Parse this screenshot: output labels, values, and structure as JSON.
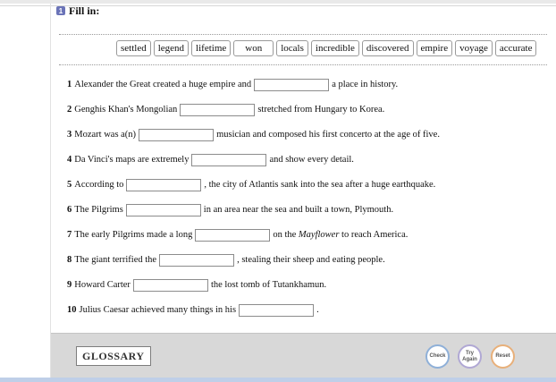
{
  "exercise": {
    "badge": "1",
    "title": "Fill in:"
  },
  "word_bank": [
    "settled",
    "legend",
    "lifetime",
    "won",
    "locals",
    "incredible",
    "discovered",
    "empire",
    "voyage",
    "accurate"
  ],
  "sentences": [
    {
      "num": "1",
      "before": "Alexander the Great created a huge empire and",
      "after": "a place in history."
    },
    {
      "num": "2",
      "before": "Genghis Khan's Mongolian",
      "after": "stretched from Hungary to Korea."
    },
    {
      "num": "3",
      "before": "Mozart was a(n)",
      "after": "musician and composed his first concerto at the age of five."
    },
    {
      "num": "4",
      "before": "Da Vinci's maps are extremely",
      "after": "and show every detail."
    },
    {
      "num": "5",
      "before": "According to",
      "after": ", the city of Atlantis sank into the sea after a huge earthquake."
    },
    {
      "num": "6",
      "before": "The Pilgrims",
      "after": "in an area near the sea and built a town, Plymouth."
    },
    {
      "num": "7",
      "before": "The early Pilgrims made a long",
      "after_italic": "Mayflower",
      "after_pre": "on the",
      "after_post": "to reach America."
    },
    {
      "num": "8",
      "before": "The giant terrified the",
      "after": ", stealing their sheep and eating people."
    },
    {
      "num": "9",
      "before": "Howard Carter",
      "after": "the lost tomb of Tutankhamun."
    },
    {
      "num": "10",
      "before": "Julius Caesar achieved many things in his",
      "after": "."
    }
  ],
  "footer": {
    "glossary_label": "GLOSSARY",
    "check_label": "Check",
    "try_again_line1": "Try",
    "try_again_line2": "Again",
    "reset_label": "Reset"
  }
}
